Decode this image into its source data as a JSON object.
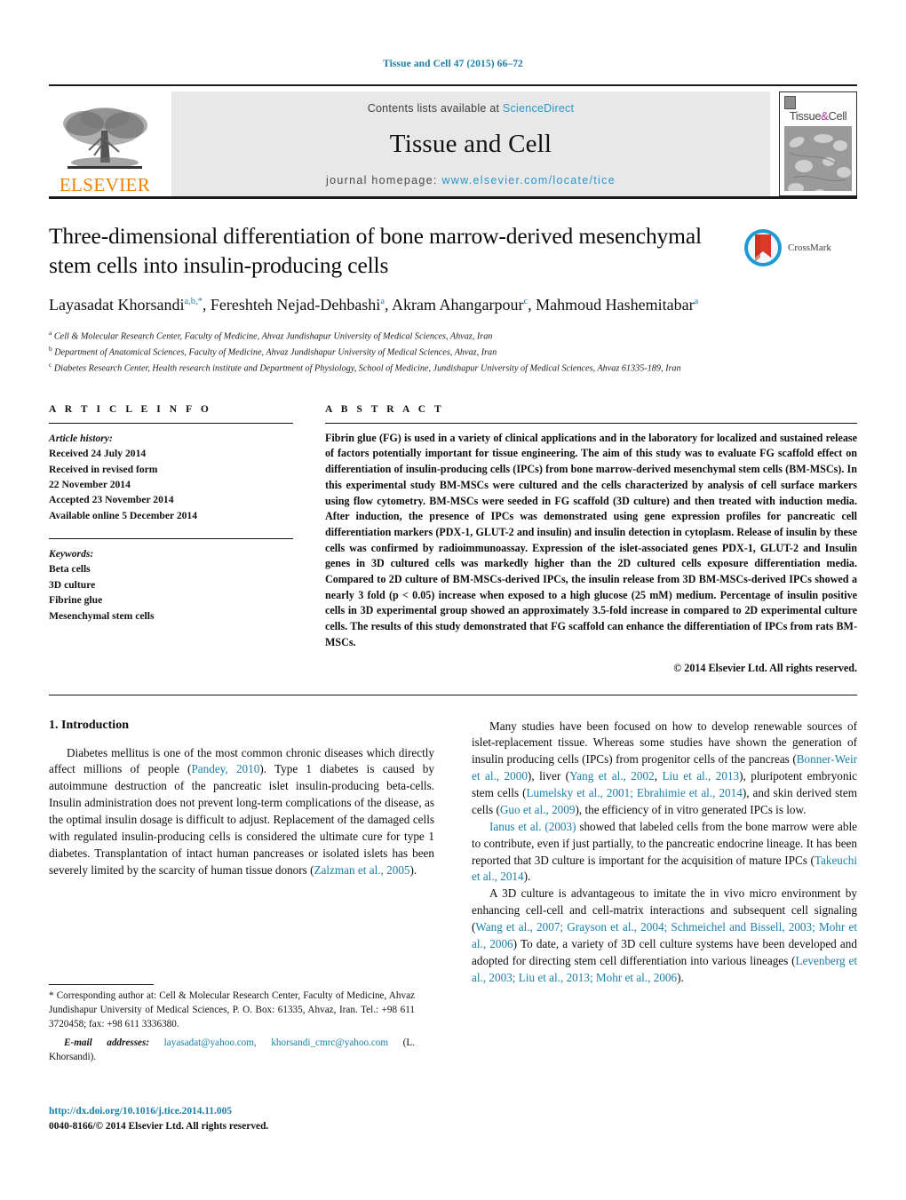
{
  "running_head": "Tissue and Cell 47 (2015) 66–72",
  "masthead": {
    "publisher_logo_text": "ELSEVIER",
    "contents_prefix": "Contents lists available at ",
    "contents_link": "ScienceDirect",
    "journal_name": "Tissue and Cell",
    "homepage_prefix": "journal homepage: ",
    "homepage_url": "www.elsevier.com/locate/tice",
    "cover_title_left": "Tissue",
    "cover_title_amp": "&",
    "cover_title_right": "Cell"
  },
  "article": {
    "title": "Three-dimensional differentiation of bone marrow-derived mesenchymal stem cells into insulin-producing cells",
    "crossmark_label": "CrossMark",
    "authors": [
      {
        "name": "Layasadat Khorsandi",
        "marks": "a,b,",
        "star": "*",
        "sep": ", "
      },
      {
        "name": "Fereshteh Nejad-Dehbashi",
        "marks": "a",
        "star": "",
        "sep": ", "
      },
      {
        "name": "Akram Ahangarpour",
        "marks": "c",
        "star": "",
        "sep": ", "
      },
      {
        "name": "Mahmoud Hashemitabar",
        "marks": "a",
        "star": "",
        "sep": ""
      }
    ],
    "affiliations": [
      {
        "mark": "a",
        "text": "Cell & Molecular Research Center, Faculty of Medicine, Ahvaz Jundishapur University of Medical Sciences, Ahvaz, Iran"
      },
      {
        "mark": "b",
        "text": "Department of Anatomical Sciences, Faculty of Medicine, Ahvaz Jundishapur University of Medical Sciences, Ahvaz, Iran"
      },
      {
        "mark": "c",
        "text": "Diabetes Research Center, Health research institute and Department of Physiology, School of Medicine, Jundishapur University of Medical Sciences, Ahvaz 61335-189, Iran"
      }
    ]
  },
  "article_info": {
    "heading": "A R T I C L E   I N F O",
    "history_label": "Article history:",
    "history": [
      "Received 24 July 2014",
      "Received in revised form",
      "22 November 2014",
      "Accepted 23 November 2014",
      "Available online 5 December 2014"
    ],
    "keywords_label": "Keywords:",
    "keywords": [
      "Beta cells",
      "3D culture",
      "Fibrine glue",
      "Mesenchymal stem cells"
    ]
  },
  "abstract": {
    "heading": "A B S T R A C T",
    "text": "Fibrin glue (FG) is used in a variety of clinical applications and in the laboratory for localized and sustained release of factors potentially important for tissue engineering. The aim of this study was to evaluate FG scaffold effect on differentiation of insulin-producing cells (IPCs) from bone marrow-derived mesenchymal stem cells (BM-MSCs). In this experimental study BM-MSCs were cultured and the cells characterized by analysis of cell surface markers using flow cytometry. BM-MSCs were seeded in FG scaffold (3D culture) and then treated with induction media. After induction, the presence of IPCs was demonstrated using gene expression profiles for pancreatic cell differentiation markers (PDX-1, GLUT-2 and insulin) and insulin detection in cytoplasm. Release of insulin by these cells was confirmed by radioimmunoassay. Expression of the islet-associated genes PDX-1, GLUT-2 and Insulin genes in 3D cultured cells was markedly higher than the 2D cultured cells exposure differentiation media. Compared to 2D culture of BM-MSCs-derived IPCs, the insulin release from 3D BM-MSCs-derived IPCs showed a nearly 3 fold (p < 0.05) increase when exposed to a high glucose (25 mM) medium. Percentage of insulin positive cells in 3D experimental group showed an approximately 3.5-fold increase in compared to 2D experimental culture cells. The results of this study demonstrated that FG scaffold can enhance the differentiation of IPCs from rats BM-MSCs.",
    "copyright": "© 2014 Elsevier Ltd. All rights reserved."
  },
  "introduction": {
    "heading": "1.  Introduction",
    "left_paragraphs": [
      {
        "parts": [
          {
            "t": "Diabetes mellitus is one of the most common chronic diseases which directly affect millions of people (",
            "c": false
          },
          {
            "t": "Pandey, 2010",
            "c": true
          },
          {
            "t": "). Type 1 diabetes is caused by autoimmune destruction of the pancreatic islet insulin-producing beta-cells. Insulin administration does not prevent long-term complications of the disease, as the optimal insulin dosage is difficult to adjust. Replacement of the damaged cells with regulated insulin-producing cells is considered the ultimate cure for type 1 diabetes. Transplantation of intact human pancreases or isolated islets has been severely limited by the scarcity of human tissue donors (",
            "c": false
          },
          {
            "t": "Zalzman et al., 2005",
            "c": true
          },
          {
            "t": ").",
            "c": false
          }
        ]
      }
    ],
    "right_paragraphs": [
      {
        "parts": [
          {
            "t": "Many studies have been focused on how to develop renewable sources of islet-replacement tissue. Whereas some studies have shown the generation of insulin producing cells (IPCs) from progenitor cells of the pancreas (",
            "c": false
          },
          {
            "t": "Bonner-Weir et al., 2000",
            "c": true
          },
          {
            "t": "), liver (",
            "c": false
          },
          {
            "t": "Yang et al., 2002",
            "c": true
          },
          {
            "t": ", ",
            "c": false
          },
          {
            "t": "Liu et al., 2013",
            "c": true
          },
          {
            "t": "), pluripotent embryonic stem cells (",
            "c": false
          },
          {
            "t": "Lumelsky et al., 2001; Ebrahimie et al., 2014",
            "c": true
          },
          {
            "t": "), and skin derived stem cells (",
            "c": false
          },
          {
            "t": "Guo et al., 2009",
            "c": true
          },
          {
            "t": "), the efficiency of in vitro generated IPCs is low.",
            "c": false
          }
        ]
      },
      {
        "parts": [
          {
            "t": "Ianus et al. (2003)",
            "c": true
          },
          {
            "t": " showed that labeled cells from the bone marrow were able to contribute, even if just partially, to the pancreatic endocrine lineage. It has been reported that 3D culture is important for the acquisition of mature IPCs (",
            "c": false
          },
          {
            "t": "Takeuchi et al., 2014",
            "c": true
          },
          {
            "t": ").",
            "c": false
          }
        ]
      },
      {
        "parts": [
          {
            "t": "A 3D culture is advantageous to imitate the in vivo micro environment by enhancing cell-cell and cell-matrix interactions and subsequent cell signaling (",
            "c": false
          },
          {
            "t": "Wang et al., 2007; Grayson et al., 2004; Schmeichel and Bissell, 2003; Mohr et al., 2006",
            "c": true
          },
          {
            "t": ") To date, a variety of 3D cell culture systems have been developed and adopted for directing stem cell differentiation into various lineages (",
            "c": false
          },
          {
            "t": "Levenberg et al., 2003; Liu et al., 2013; Mohr et al., 2006",
            "c": true
          },
          {
            "t": ").",
            "c": false
          }
        ]
      }
    ]
  },
  "footnotes": {
    "corresponding": "* Corresponding author at: Cell & Molecular Research Center, Faculty of Medicine, Ahvaz Jundishapur University of Medical Sciences, P. O. Box: 61335, Ahvaz, Iran. Tel.: +98 611 3720458; fax: +98 611 3336380.",
    "email_label": "E-mail addresses:",
    "emails": "layasadat@yahoo.com, khorsandi_cmrc@yahoo.com",
    "email_owner": "(L. Khorsandi).",
    "doi": "http://dx.doi.org/10.1016/j.tice.2014.11.005",
    "issn_line": "0040-8166/© 2014 Elsevier Ltd. All rights reserved."
  },
  "colors": {
    "link": "#1a7fa8",
    "sciencedirect": "#2b96c8",
    "elsevier_orange": "#f08000",
    "masthead_gray": "#e8e8e8"
  }
}
